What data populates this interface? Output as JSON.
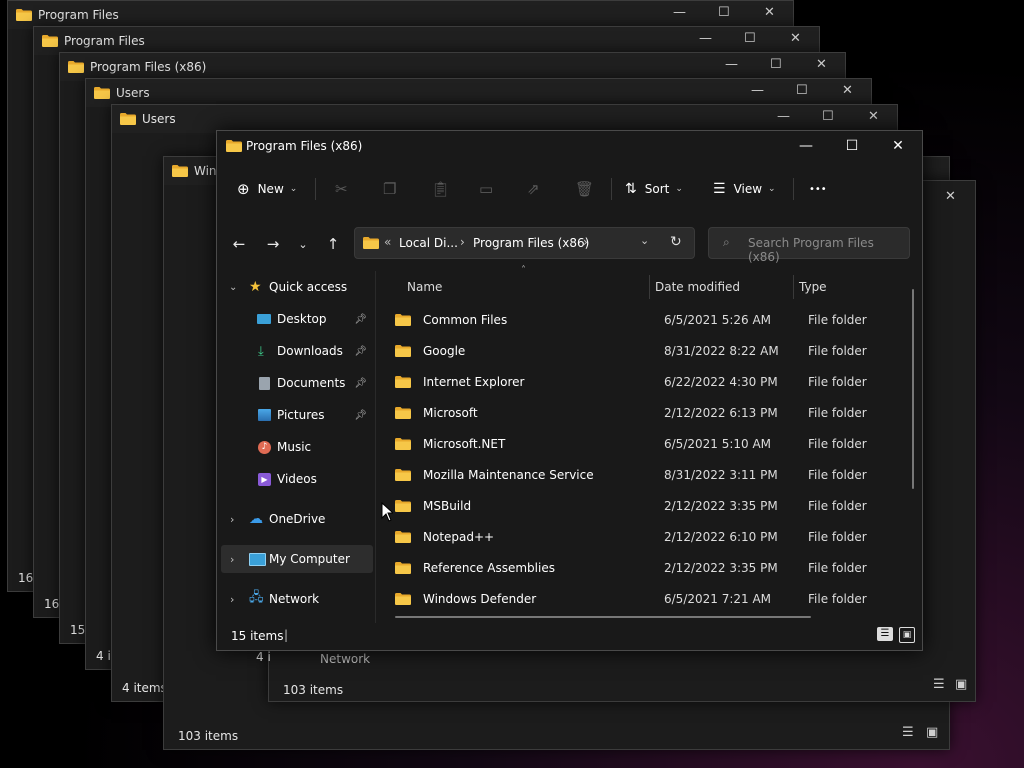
{
  "background_windows": [
    {
      "title": "Program Files",
      "count": "16"
    },
    {
      "title": "Program Files",
      "count": "16"
    },
    {
      "title": "Program Files (x86)",
      "count": "15"
    },
    {
      "title": "Users",
      "count": "4 i"
    },
    {
      "title": "Users",
      "count": "4 items"
    },
    {
      "title": "Wind",
      "count": "15"
    },
    {
      "title": "",
      "count": "103 items"
    },
    {
      "title": "",
      "count": "103 items"
    },
    {
      "title": "",
      "count": "4 i"
    }
  ],
  "background_fragments": {
    "new_label": "N",
    "network_label": "Network"
  },
  "window": {
    "title": "Program Files (x86)",
    "minimize": "—",
    "maximize": "☐",
    "close": "✕"
  },
  "toolbar": {
    "new_label": "New",
    "sort_label": "Sort",
    "view_label": "View",
    "more_label": "•••"
  },
  "address": {
    "overflow": "«",
    "crumb1": "Local Di...",
    "crumb2": "Program Files (x86)",
    "sep": "›"
  },
  "search": {
    "placeholder": "Search Program Files (x86)"
  },
  "navpane": {
    "items": [
      {
        "label": "Quick access"
      },
      {
        "label": "Desktop"
      },
      {
        "label": "Downloads"
      },
      {
        "label": "Documents"
      },
      {
        "label": "Pictures"
      },
      {
        "label": "Music"
      },
      {
        "label": "Videos"
      },
      {
        "label": "OneDrive"
      },
      {
        "label": "My Computer"
      },
      {
        "label": "Network"
      }
    ]
  },
  "columns": {
    "name": "Name",
    "date": "Date modified",
    "type": "Type"
  },
  "files": [
    {
      "name": "Common Files",
      "date": "6/5/2021 5:26 AM",
      "type": "File folder"
    },
    {
      "name": "Google",
      "date": "8/31/2022 8:22 AM",
      "type": "File folder"
    },
    {
      "name": "Internet Explorer",
      "date": "6/22/2022 4:30 PM",
      "type": "File folder"
    },
    {
      "name": "Microsoft",
      "date": "2/12/2022 6:13 PM",
      "type": "File folder"
    },
    {
      "name": "Microsoft.NET",
      "date": "6/5/2021 5:10 AM",
      "type": "File folder"
    },
    {
      "name": "Mozilla Maintenance Service",
      "date": "8/31/2022 3:11 PM",
      "type": "File folder"
    },
    {
      "name": "MSBuild",
      "date": "2/12/2022 3:35 PM",
      "type": "File folder"
    },
    {
      "name": "Notepad++",
      "date": "2/12/2022 6:10 PM",
      "type": "File folder"
    },
    {
      "name": "Reference Assemblies",
      "date": "2/12/2022 3:35 PM",
      "type": "File folder"
    },
    {
      "name": "Windows Defender",
      "date": "6/5/2021 7:21 AM",
      "type": "File folder"
    }
  ],
  "status": {
    "count": "15 items"
  },
  "colors": {
    "folder": "#f3c13a",
    "accent": "#4cc2ff",
    "bg": "#191919"
  }
}
